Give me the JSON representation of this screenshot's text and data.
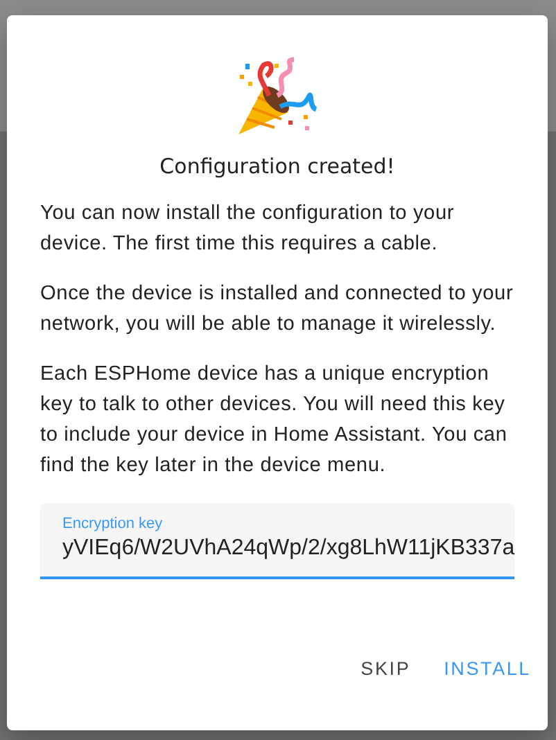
{
  "dialog": {
    "title": "Configuration created!",
    "paragraphs": [
      "You can now install the configuration to your device. The first time this requires a cable.",
      "Once the device is installed and connected to your network, you will be able to manage it wirelessly.",
      "Each ESPHome device has a unique encryption key to talk to other devices. You will need this key to include your device in Home Assistant. You can find the key later in the device menu."
    ],
    "field": {
      "label": "Encryption key",
      "value": "yVIEq6/W2UVhA24qWp/2/xg8LhW11jKB337a",
      "focused": true
    },
    "buttons": [
      {
        "label": "SKIP",
        "kind": "secondary"
      },
      {
        "label": "INSTALL",
        "kind": "primary"
      }
    ]
  }
}
